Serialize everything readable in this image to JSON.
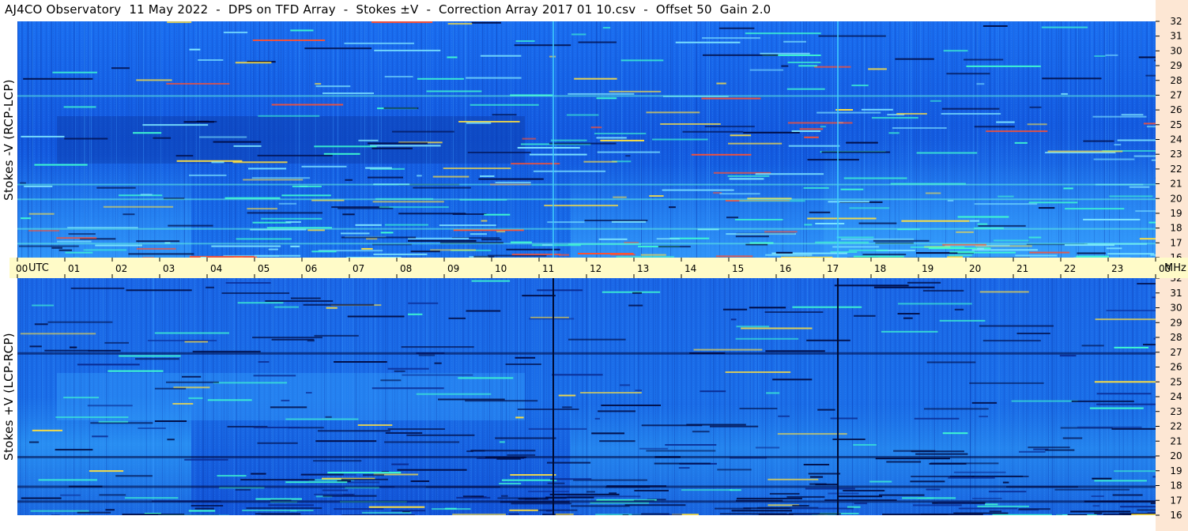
{
  "title": "AJ4CO Observatory  11 May 2022  -  DPS on TFD Array  -  Stokes ±V  -  Correction Array 2017 01 10.csv  -  Offset 50  Gain 2.0",
  "top_panel": {
    "ylabel": "Stokes -V (RCP-LCP)"
  },
  "bottom_panel": {
    "ylabel": "Stokes +V (LCP-RCP)"
  },
  "time_axis": {
    "labels": [
      "00",
      "01",
      "02",
      "03",
      "04",
      "05",
      "06",
      "07",
      "08",
      "09",
      "10",
      "11",
      "12",
      "13",
      "14",
      "15",
      "16",
      "17",
      "18",
      "19",
      "20",
      "21",
      "22",
      "23",
      "00"
    ],
    "utc_label": "UTC",
    "unit_label": "MHz"
  },
  "colors": {
    "background": "#1060e8",
    "time_axis_bg": "#fffbc8",
    "freq_axis_bg": "#fde7d4"
  },
  "chart_data": [
    {
      "type": "heatmap",
      "title": "Stokes -V (RCP-LCP)",
      "x": {
        "label": "UTC",
        "range": [
          "00",
          "24"
        ],
        "ticks": [
          "00",
          "01",
          "02",
          "03",
          "04",
          "05",
          "06",
          "07",
          "08",
          "09",
          "10",
          "11",
          "12",
          "13",
          "14",
          "15",
          "16",
          "17",
          "18",
          "19",
          "20",
          "21",
          "22",
          "23",
          "00"
        ]
      },
      "y": {
        "label": "MHz",
        "range": [
          16,
          32
        ],
        "ticks": [
          16,
          17,
          18,
          19,
          20,
          21,
          22,
          23,
          24,
          25,
          26,
          27,
          28,
          29,
          30,
          31,
          32
        ]
      },
      "notable_vertical_lines_utc": [
        11.3,
        17.3
      ],
      "notable_bright_bands_mhz": [
        17.0,
        18.0,
        20.0,
        21.0,
        27.0
      ]
    },
    {
      "type": "heatmap",
      "title": "Stokes +V (LCP-RCP)",
      "x": {
        "label": "UTC",
        "range": [
          "00",
          "24"
        ],
        "ticks": [
          "00",
          "01",
          "02",
          "03",
          "04",
          "05",
          "06",
          "07",
          "08",
          "09",
          "10",
          "11",
          "12",
          "13",
          "14",
          "15",
          "16",
          "17",
          "18",
          "19",
          "20",
          "21",
          "22",
          "23",
          "00"
        ]
      },
      "y": {
        "label": "MHz",
        "range": [
          16,
          32
        ],
        "ticks": [
          16,
          17,
          18,
          19,
          20,
          21,
          22,
          23,
          24,
          25,
          26,
          27,
          28,
          29,
          30,
          31,
          32
        ]
      },
      "notable_vertical_lines_utc": [
        11.3,
        17.3
      ],
      "notable_dark_bands_mhz": [
        17.0,
        18.0,
        20.0,
        27.0
      ]
    }
  ]
}
